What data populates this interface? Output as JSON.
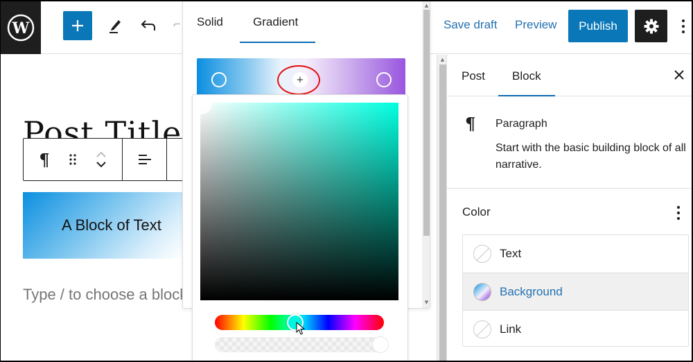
{
  "topbar": {
    "logo_icon": "wordpress-logo-icon",
    "add_block_icon": "plus-icon",
    "tools_icon": "pencil-icon",
    "undo_icon": "undo-icon",
    "redo_icon": "redo-icon",
    "save_draft_label": "Save draft",
    "preview_label": "Preview",
    "publish_label": "Publish",
    "settings_icon": "gear-icon",
    "more_icon": "vertical-ellipsis-icon"
  },
  "editor": {
    "post_title": "Post Title",
    "block_toolbar": {
      "block_type_glyph": "¶",
      "drag_icon": "drag-handle-icon",
      "move_up_icon": "chevron-up-icon",
      "move_down_icon": "chevron-down-icon",
      "align_icon": "align-left-icon"
    },
    "text_block": "A Block of Text",
    "placeholder": "Type / to choose a block"
  },
  "color_popover": {
    "tabs": [
      {
        "label": "Solid",
        "active": false
      },
      {
        "label": "Gradient",
        "active": true
      }
    ],
    "gradient": {
      "start_color": "#0b8ee0",
      "end_color": "#9a55e0",
      "add_stop_label": "+"
    },
    "picker": {
      "hue_color": "#00ffe0"
    }
  },
  "sidebar": {
    "tabs": [
      {
        "label": "Post",
        "active": false
      },
      {
        "label": "Block",
        "active": true
      }
    ],
    "close_icon": "close-icon",
    "block_card": {
      "icon_glyph": "¶",
      "name": "Paragraph",
      "description": "Start with the basic building block of all narrative."
    },
    "color_panel": {
      "title": "Color",
      "items": [
        {
          "label": "Text",
          "swatch": "none"
        },
        {
          "label": "Background",
          "swatch": "gradient",
          "active": true
        },
        {
          "label": "Link",
          "swatch": "none"
        }
      ]
    }
  },
  "colors": {
    "accent": "#0a78b8",
    "dark": "#1e1e1e",
    "link": "#2271b1"
  }
}
